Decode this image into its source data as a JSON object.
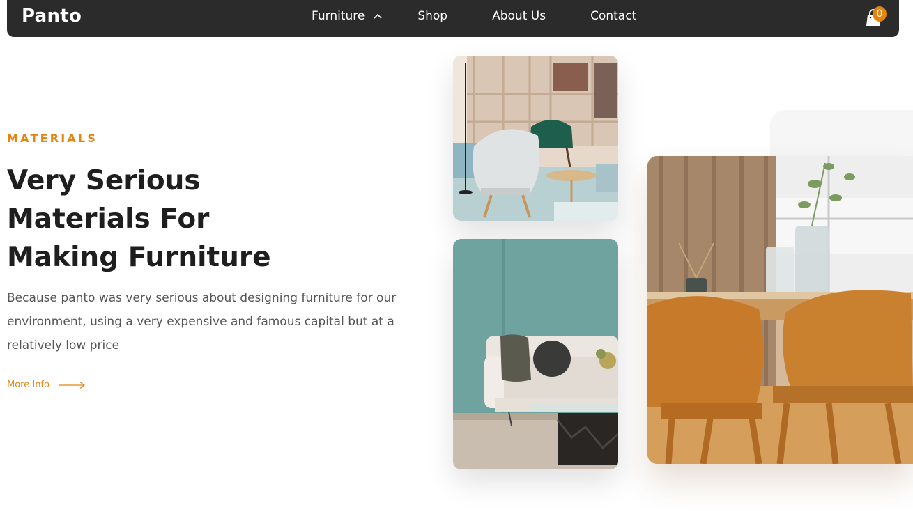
{
  "nav": {
    "brand": "Panto",
    "links": [
      {
        "label": "Furniture",
        "has_dropdown": true
      },
      {
        "label": "Shop"
      },
      {
        "label": "About Us"
      },
      {
        "label": "Contact"
      }
    ],
    "cart_count": "0",
    "cart_icon": "shopping-bag-icon",
    "dropdown_icon": "chevron-up-icon"
  },
  "hero": {
    "eyebrow": "MATERIALS",
    "heading_lines": [
      "Very Serious",
      "Materials For",
      "Making Furniture"
    ],
    "description": "Because panto was very serious about designing furniture for our environment, using a very expensive and famous capital but at a relatively low price",
    "cta_label": "More Info",
    "cta_icon": "arrow-right-icon"
  },
  "images": [
    {
      "name": "interior-lounge-chairs-photo"
    },
    {
      "name": "living-room-sofa-photo"
    },
    {
      "name": "dining-chairs-photo"
    }
  ],
  "colors": {
    "accent": "#e58411",
    "nav_bg": "#2b2b2b",
    "heading": "#1e1e1e",
    "body_text": "#555555"
  }
}
